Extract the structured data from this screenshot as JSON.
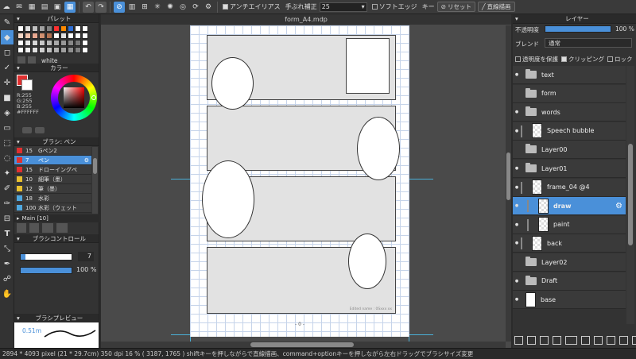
{
  "toolbar": {
    "antialias_label": "アンチエイリアス",
    "stabilizer_label": "手ぶれ補正",
    "stabilizer_value": "25",
    "soft_edge_label": "ソフトエッジ",
    "key_label": "キー",
    "reset_label": "リセット",
    "straight_line_label": "直線描画"
  },
  "document": {
    "tab_title": "form_A4.mdp",
    "page_number": "- 0 -",
    "edited_note": "Edited name : 0Sxxx xx"
  },
  "palette": {
    "title": "パレット",
    "color_name": "white",
    "colors": [
      "#ffffff",
      "#e0e0e0",
      "#c0c0c0",
      "#a0a0a0",
      "#808080",
      "#ff3030",
      "#ff8a00",
      "#2f6fd6",
      "#ffffff",
      "#ffffff",
      "#f4d8c8",
      "#f0c0a8",
      "#e8a890",
      "#d09070",
      "#b07050",
      "#ffffff",
      "#e0e0e0",
      "#ffffff",
      "#ffffff",
      "#ffffff",
      "#ffffff",
      "#e8e8e8",
      "#d8d8d8",
      "#c8c8c8",
      "#b8b8b8",
      "#a8a8a8",
      "#989898",
      "#888888",
      "#787878",
      "#ffffff",
      "#ffffff",
      "#f0f0f0",
      "#e0e0e0",
      "#d0d0d0",
      "#c0c0c0",
      "#b0b0b0",
      "#a0a0a0",
      "#909090",
      "#808080",
      "#ffffff"
    ]
  },
  "color_panel": {
    "title": "カラー",
    "r": "R:255",
    "g": "G:255",
    "b": "B:255",
    "hex": "#FFFFFF"
  },
  "brush_panel": {
    "title": "ブラシ: ペン",
    "items": [
      {
        "size": "15",
        "name": "Gペン2",
        "color": "#e03030"
      },
      {
        "size": "7",
        "name": "ペン",
        "color": "#e03030",
        "selected": true
      },
      {
        "size": "15",
        "name": "ドローイングペ",
        "color": "#e03030"
      },
      {
        "size": "10",
        "name": "細筆（墨）",
        "color": "#e8c030"
      },
      {
        "size": "12",
        "name": "筆（墨）",
        "color": "#e8c030"
      },
      {
        "size": "18",
        "name": "水彩",
        "color": "#4fa8e0"
      },
      {
        "size": "100",
        "name": "水彩（ウェット",
        "color": "#4fa8e0"
      }
    ],
    "group_label": "Main [10]"
  },
  "brush_control": {
    "title": "ブラシコントロール",
    "size_value": "7",
    "opacity_value": "100 %"
  },
  "brush_preview": {
    "title": "ブラシプレビュー",
    "size_text": "0.51m"
  },
  "layers": {
    "title": "レイヤー",
    "opacity_label": "不透明度",
    "opacity_value": "100 %",
    "blend_label": "ブレンド",
    "blend_value": "通常",
    "protect_label": "透明度を保護",
    "clipping_label": "クリッピング",
    "lock_label": "ロック",
    "items": [
      {
        "name": "text",
        "kind": "folder",
        "indent": 0,
        "eye": true
      },
      {
        "name": "form",
        "kind": "folder",
        "indent": 0,
        "eye": false
      },
      {
        "name": "words",
        "kind": "folder",
        "indent": 0,
        "eye": true
      },
      {
        "name": "Speech bubble",
        "kind": "layer",
        "indent": 1,
        "eye": true
      },
      {
        "name": "Layer00",
        "kind": "folder",
        "indent": 0,
        "eye": false
      },
      {
        "name": "Layer01",
        "kind": "folder",
        "indent": 0,
        "eye": true
      },
      {
        "name": "frame_04 @4",
        "kind": "layer",
        "indent": 1,
        "eye": true
      },
      {
        "name": "draw",
        "kind": "layer",
        "indent": 2,
        "eye": true,
        "selected": true
      },
      {
        "name": "paint",
        "kind": "layer",
        "indent": 2,
        "eye": true
      },
      {
        "name": "back",
        "kind": "layer",
        "indent": 1,
        "eye": true
      },
      {
        "name": "Layer02",
        "kind": "folder",
        "indent": 0,
        "eye": false
      },
      {
        "name": "Draft",
        "kind": "folder",
        "indent": 0,
        "eye": true
      },
      {
        "name": "base",
        "kind": "layer-white",
        "indent": 0,
        "eye": true
      }
    ]
  },
  "status": {
    "text": "2894 * 4093 pixel   (21 * 29.7cm)   350 dpi   16 %   ( 3187, 1765 )   shiftキーを押しながらで直線描画、command+optionキーを押しながら左右ドラッグでブラシサイズ変更"
  },
  "colors": {
    "accent": "#4a90d9",
    "panel_bg": "#333333",
    "canvas_bg": "#4a4a4a"
  }
}
